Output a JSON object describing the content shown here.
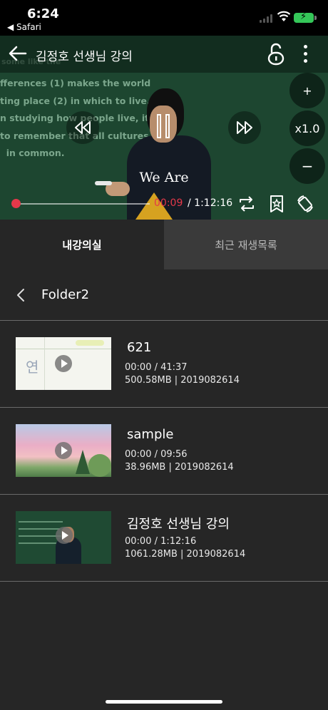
{
  "status_bar": {
    "time": "6:24",
    "back_app": "◀ Safari"
  },
  "player": {
    "title": "김정호 선생님 강의",
    "board_text_top": "some like the",
    "board_text": "fferences (1) makes the world\nting place (2) in which to live.\nn studying how people live, it is\nto remember that all cultures\n  in common.",
    "subtitle": "We Are",
    "speed": "x1.0",
    "plus": "+",
    "minus": "−",
    "current_time": "00:09",
    "total_time": "/ 1:12:16",
    "progress_fraction": 0.0
  },
  "tabs": [
    {
      "label": "내강의실",
      "active": true
    },
    {
      "label": "최근 재생목록",
      "active": false
    }
  ],
  "folder": {
    "name": "Folder2"
  },
  "items": [
    {
      "name": "621",
      "time": "00:00 / 41:37",
      "meta": "500.58MB  |  2019082614",
      "thumb": "whiteboard"
    },
    {
      "name": "sample",
      "time": "00:00 / 09:56",
      "meta": "38.96MB  |  2019082614",
      "thumb": "landscape"
    },
    {
      "name": "김정호 선생님 강의",
      "time": "00:00 / 1:12:16",
      "meta": "1061.28MB  |  2019082614",
      "thumb": "lecture"
    }
  ],
  "colors": {
    "accent": "#e5384a",
    "background": "#262626",
    "tab_inactive": "#3a3a3a"
  }
}
